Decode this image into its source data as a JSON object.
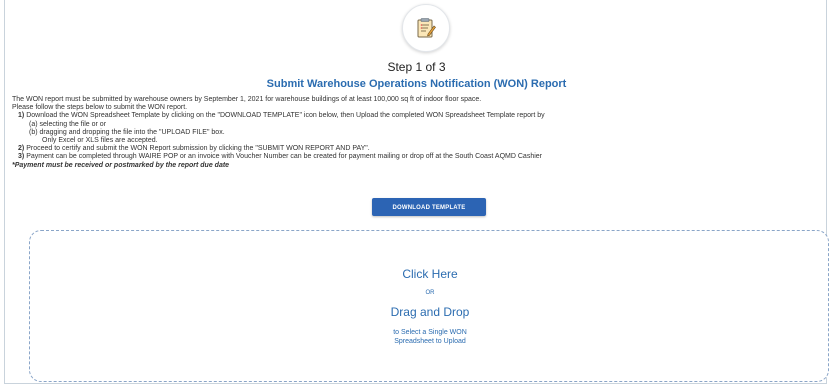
{
  "header": {
    "icon": "form-edit-icon",
    "step": "Step 1 of 3",
    "title": "Submit Warehouse Operations Notification (WON) Report"
  },
  "instructions": {
    "intro": "The WON report must be submitted by warehouse owners by September 1, 2021 for warehouse buildings of at least 100,000 sq ft of indoor floor space.",
    "follow": "Please follow the steps below to submit the WON report.",
    "step1_num": "1)",
    "step1": "Download the WON Spreadsheet Template by clicking on the \"DOWNLOAD TEMPLATE\" icon below, then Upload the completed WON Spreadsheet Template report by",
    "step1a": "(a) selecting the file or or",
    "step1b": "(b) dragging and dropping the file into the \"UPLOAD FILE\" box.",
    "step1c": "Only Excel or XLS files are accepted.",
    "step2_num": "2)",
    "step2": "Proceed to certify and submit the WON Report submission by clicking the \"SUBMIT WON REPORT AND PAY\".",
    "step3_num": "3)",
    "step3": "Payment can be completed through WAIRE POP or an invoice with Voucher Number can be created for payment mailing or drop off at the South Coast AQMD Cashier",
    "note": "*Payment must be received or postmarked by the report due date"
  },
  "download_button": {
    "label": "DOWNLOAD TEMPLATE"
  },
  "dropzone": {
    "click_here": "Click Here",
    "or": "OR",
    "drag_drop": "Drag and Drop",
    "desc_line1": "to Select a Single WON",
    "desc_line2": "Spreadsheet to Upload"
  },
  "colors": {
    "accent": "#2b6cb0",
    "button": "#2c64b4"
  }
}
